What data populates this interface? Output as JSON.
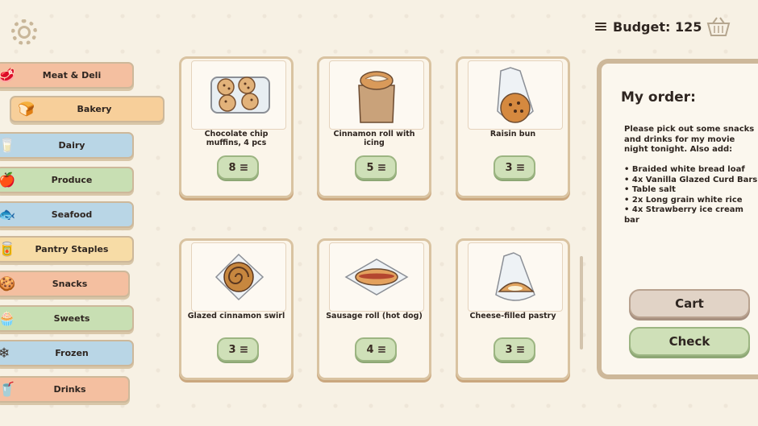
{
  "header": {
    "budget_label": "Budget: 125",
    "settings_icon": "gear-icon",
    "basket_icon": "basket-icon"
  },
  "categories": [
    {
      "label": "Meat & Deli",
      "color": "#f4bfa0",
      "icon": "meat-icon",
      "glyph": "🥩"
    },
    {
      "label": "Bakery",
      "color": "#f7cf9a",
      "icon": "bread-icon",
      "glyph": "🍞"
    },
    {
      "label": "Dairy",
      "color": "#b9d6e6",
      "icon": "milk-icon",
      "glyph": "🥛"
    },
    {
      "label": "Produce",
      "color": "#c8dfb3",
      "icon": "apple-icon",
      "glyph": "🍎"
    },
    {
      "label": "Seafood",
      "color": "#b9d6e6",
      "icon": "fish-icon",
      "glyph": "🐟"
    },
    {
      "label": "Pantry Staples",
      "color": "#f7dca6",
      "icon": "pantry-icon",
      "glyph": "🥫"
    },
    {
      "label": "Snacks",
      "color": "#f4bfa0",
      "icon": "chips-icon",
      "glyph": "🍪"
    },
    {
      "label": "Sweets",
      "color": "#c8dfb3",
      "icon": "cupcake-icon",
      "glyph": "🧁"
    },
    {
      "label": "Frozen",
      "color": "#b9d6e6",
      "icon": "snowflake-icon",
      "glyph": "❄"
    },
    {
      "label": "Drinks",
      "color": "#f4bfa0",
      "icon": "bottle-icon",
      "glyph": "🥤"
    }
  ],
  "products": [
    {
      "name": "Chocolate chip muffins, 4 pcs",
      "price": "8"
    },
    {
      "name": "Cinnamon roll with icing",
      "price": "5"
    },
    {
      "name": "Raisin bun",
      "price": "3"
    },
    {
      "name": "Glazed cinnamon swirl",
      "price": "3"
    },
    {
      "name": "Sausage roll (hot dog)",
      "price": "4"
    },
    {
      "name": "Cheese-filled pastry",
      "price": "3"
    }
  ],
  "order": {
    "title": "My order:",
    "request": "Please pick out some snacks and drinks for my movie night tonight. Also add:\n\n• Braided white bread loaf\n• 4x Vanilla Glazed Curd Bars\n• Table salt\n• 2x Long grain white rice\n• 4x Strawberry ice cream bar",
    "cart_label": "Cart",
    "check_label": "Check"
  }
}
